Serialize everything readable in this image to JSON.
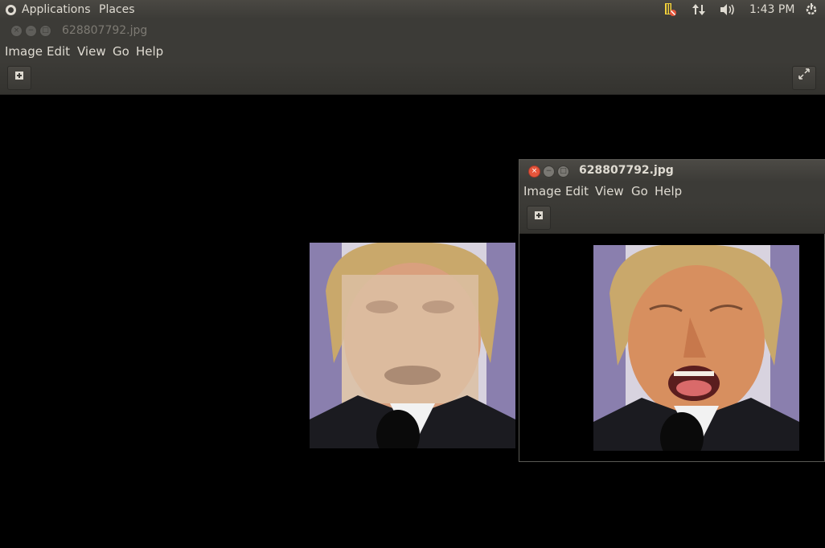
{
  "top_panel": {
    "menus": [
      "Applications",
      "Places"
    ],
    "clock": "1:43 PM",
    "indicators": [
      "keyboard-indicator-icon",
      "network-icon",
      "volume-icon",
      "session-gear-icon"
    ]
  },
  "back_window": {
    "title": "628807792.jpg",
    "menu": [
      "Image",
      "Edit",
      "View",
      "Go",
      "Help"
    ],
    "toolbar": {
      "add_icon": "plus-icon",
      "fullscreen_icon": "fullscreen-icon"
    },
    "image": {
      "description_icon": "face-image-swapped"
    }
  },
  "front_window": {
    "title": "628807792.jpg",
    "menu": [
      "Image",
      "Edit",
      "View",
      "Go",
      "Help"
    ],
    "toolbar": {
      "add_icon": "plus-icon"
    },
    "image": {
      "description_icon": "face-image-original"
    }
  },
  "colors": {
    "panel": "#3c3b37",
    "text": "#dfdbd2",
    "close": "#e5553b",
    "background": "#000000"
  }
}
